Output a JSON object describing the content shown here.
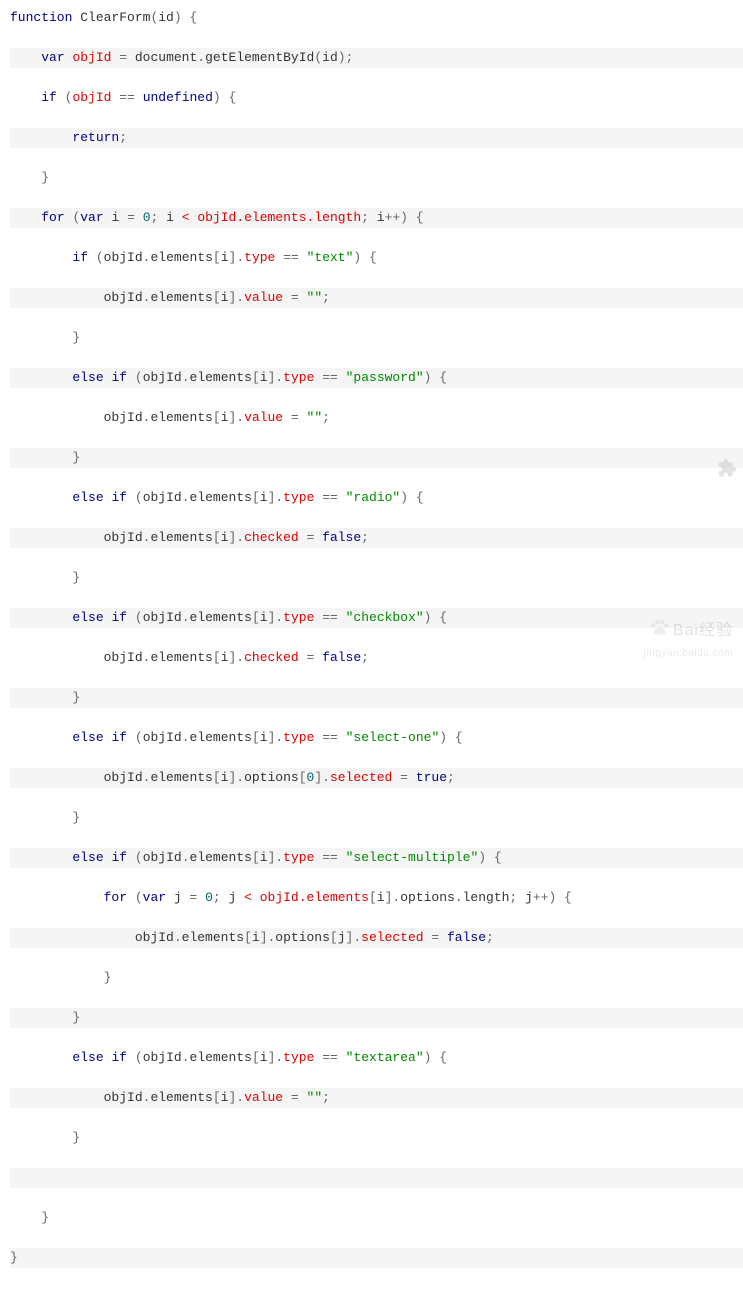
{
  "code": {
    "lines": [
      [
        [
          "kw",
          "function"
        ],
        [
          "id",
          " ClearForm"
        ],
        [
          "punc",
          "("
        ],
        [
          "id",
          "id"
        ],
        [
          "punc",
          ") {"
        ]
      ],
      [
        [
          "id",
          "    "
        ],
        [
          "kw",
          "var"
        ],
        [
          "id",
          " "
        ],
        [
          "err",
          "objId"
        ],
        [
          "id",
          " "
        ],
        [
          "punc",
          "="
        ],
        [
          "id",
          " document"
        ],
        [
          "punc",
          "."
        ],
        [
          "id",
          "getElementById"
        ],
        [
          "punc",
          "("
        ],
        [
          "id",
          "id"
        ],
        [
          "punc",
          ");"
        ]
      ],
      [
        [
          "id",
          "    "
        ],
        [
          "kw",
          "if"
        ],
        [
          "id",
          " "
        ],
        [
          "punc",
          "("
        ],
        [
          "err",
          "objId"
        ],
        [
          "id",
          " "
        ],
        [
          "punc",
          "=="
        ],
        [
          "id",
          " "
        ],
        [
          "bool",
          "undefined"
        ],
        [
          "punc",
          ") {"
        ]
      ],
      [
        [
          "id",
          "        "
        ],
        [
          "kw",
          "return"
        ],
        [
          "punc",
          ";"
        ]
      ],
      [
        [
          "id",
          "    "
        ],
        [
          "punc",
          "}"
        ]
      ],
      [
        [
          "id",
          "    "
        ],
        [
          "kw",
          "for"
        ],
        [
          "id",
          " "
        ],
        [
          "punc",
          "("
        ],
        [
          "kw",
          "var"
        ],
        [
          "id",
          " i "
        ],
        [
          "punc",
          "="
        ],
        [
          "id",
          " "
        ],
        [
          "num",
          "0"
        ],
        [
          "punc",
          ";"
        ],
        [
          "id",
          " i "
        ],
        [
          "err",
          "< objId.elements.length"
        ],
        [
          "punc",
          ";"
        ],
        [
          "id",
          " i"
        ],
        [
          "punc",
          "++) {"
        ]
      ],
      [
        [
          "id",
          "        "
        ],
        [
          "kw",
          "if"
        ],
        [
          "id",
          " "
        ],
        [
          "punc",
          "("
        ],
        [
          "id",
          "objId"
        ],
        [
          "punc",
          "."
        ],
        [
          "id",
          "elements"
        ],
        [
          "punc",
          "["
        ],
        [
          "id",
          "i"
        ],
        [
          "punc",
          "]."
        ],
        [
          "err",
          "type"
        ],
        [
          "id",
          " "
        ],
        [
          "punc",
          "=="
        ],
        [
          "id",
          " "
        ],
        [
          "str",
          "\"text\""
        ],
        [
          "punc",
          ") {"
        ]
      ],
      [
        [
          "id",
          "            objId"
        ],
        [
          "punc",
          "."
        ],
        [
          "id",
          "elements"
        ],
        [
          "punc",
          "["
        ],
        [
          "id",
          "i"
        ],
        [
          "punc",
          "]."
        ],
        [
          "err",
          "value"
        ],
        [
          "id",
          " "
        ],
        [
          "punc",
          "="
        ],
        [
          "id",
          " "
        ],
        [
          "str",
          "\"\""
        ],
        [
          "punc",
          ";"
        ]
      ],
      [
        [
          "id",
          "        "
        ],
        [
          "punc",
          "}"
        ]
      ],
      [
        [
          "id",
          "        "
        ],
        [
          "kw",
          "else"
        ],
        [
          "id",
          " "
        ],
        [
          "kw",
          "if"
        ],
        [
          "id",
          " "
        ],
        [
          "punc",
          "("
        ],
        [
          "id",
          "objId"
        ],
        [
          "punc",
          "."
        ],
        [
          "id",
          "elements"
        ],
        [
          "punc",
          "["
        ],
        [
          "id",
          "i"
        ],
        [
          "punc",
          "]."
        ],
        [
          "err",
          "type"
        ],
        [
          "id",
          " "
        ],
        [
          "punc",
          "=="
        ],
        [
          "id",
          " "
        ],
        [
          "str",
          "\"password\""
        ],
        [
          "punc",
          ") {"
        ]
      ],
      [
        [
          "id",
          "            objId"
        ],
        [
          "punc",
          "."
        ],
        [
          "id",
          "elements"
        ],
        [
          "punc",
          "["
        ],
        [
          "id",
          "i"
        ],
        [
          "punc",
          "]."
        ],
        [
          "err",
          "value"
        ],
        [
          "id",
          " "
        ],
        [
          "punc",
          "="
        ],
        [
          "id",
          " "
        ],
        [
          "str",
          "\"\""
        ],
        [
          "punc",
          ";"
        ]
      ],
      [
        [
          "id",
          "        "
        ],
        [
          "punc",
          "}"
        ]
      ],
      [
        [
          "id",
          "        "
        ],
        [
          "kw",
          "else"
        ],
        [
          "id",
          " "
        ],
        [
          "kw",
          "if"
        ],
        [
          "id",
          " "
        ],
        [
          "punc",
          "("
        ],
        [
          "id",
          "objId"
        ],
        [
          "punc",
          "."
        ],
        [
          "id",
          "elements"
        ],
        [
          "punc",
          "["
        ],
        [
          "id",
          "i"
        ],
        [
          "punc",
          "]."
        ],
        [
          "err",
          "type"
        ],
        [
          "id",
          " "
        ],
        [
          "punc",
          "=="
        ],
        [
          "id",
          " "
        ],
        [
          "str",
          "\"radio\""
        ],
        [
          "punc",
          ") {"
        ]
      ],
      [
        [
          "id",
          "            objId"
        ],
        [
          "punc",
          "."
        ],
        [
          "id",
          "elements"
        ],
        [
          "punc",
          "["
        ],
        [
          "id",
          "i"
        ],
        [
          "punc",
          "]."
        ],
        [
          "err",
          "checked"
        ],
        [
          "id",
          " "
        ],
        [
          "punc",
          "="
        ],
        [
          "id",
          " "
        ],
        [
          "bool",
          "false"
        ],
        [
          "punc",
          ";"
        ]
      ],
      [
        [
          "id",
          "        "
        ],
        [
          "punc",
          "}"
        ]
      ],
      [
        [
          "id",
          "        "
        ],
        [
          "kw",
          "else"
        ],
        [
          "id",
          " "
        ],
        [
          "kw",
          "if"
        ],
        [
          "id",
          " "
        ],
        [
          "punc",
          "("
        ],
        [
          "id",
          "objId"
        ],
        [
          "punc",
          "."
        ],
        [
          "id",
          "elements"
        ],
        [
          "punc",
          "["
        ],
        [
          "id",
          "i"
        ],
        [
          "punc",
          "]."
        ],
        [
          "err",
          "type"
        ],
        [
          "id",
          " "
        ],
        [
          "punc",
          "=="
        ],
        [
          "id",
          " "
        ],
        [
          "str",
          "\"checkbox\""
        ],
        [
          "punc",
          ") {"
        ]
      ],
      [
        [
          "id",
          "            objId"
        ],
        [
          "punc",
          "."
        ],
        [
          "id",
          "elements"
        ],
        [
          "punc",
          "["
        ],
        [
          "id",
          "i"
        ],
        [
          "punc",
          "]."
        ],
        [
          "err",
          "checked"
        ],
        [
          "id",
          " "
        ],
        [
          "punc",
          "="
        ],
        [
          "id",
          " "
        ],
        [
          "bool",
          "false"
        ],
        [
          "punc",
          ";"
        ]
      ],
      [
        [
          "id",
          "        "
        ],
        [
          "punc",
          "}"
        ]
      ],
      [
        [
          "id",
          "        "
        ],
        [
          "kw",
          "else"
        ],
        [
          "id",
          " "
        ],
        [
          "kw",
          "if"
        ],
        [
          "id",
          " "
        ],
        [
          "punc",
          "("
        ],
        [
          "id",
          "objId"
        ],
        [
          "punc",
          "."
        ],
        [
          "id",
          "elements"
        ],
        [
          "punc",
          "["
        ],
        [
          "id",
          "i"
        ],
        [
          "punc",
          "]."
        ],
        [
          "err",
          "type"
        ],
        [
          "id",
          " "
        ],
        [
          "punc",
          "=="
        ],
        [
          "id",
          " "
        ],
        [
          "str",
          "\"select-one\""
        ],
        [
          "punc",
          ") {"
        ]
      ],
      [
        [
          "id",
          "            objId"
        ],
        [
          "punc",
          "."
        ],
        [
          "id",
          "elements"
        ],
        [
          "punc",
          "["
        ],
        [
          "id",
          "i"
        ],
        [
          "punc",
          "]."
        ],
        [
          "id",
          "options"
        ],
        [
          "punc",
          "["
        ],
        [
          "num",
          "0"
        ],
        [
          "punc",
          "]."
        ],
        [
          "err",
          "selected"
        ],
        [
          "id",
          " "
        ],
        [
          "punc",
          "="
        ],
        [
          "id",
          " "
        ],
        [
          "bool",
          "true"
        ],
        [
          "punc",
          ";"
        ]
      ],
      [
        [
          "id",
          "        "
        ],
        [
          "punc",
          "}"
        ]
      ],
      [
        [
          "id",
          "        "
        ],
        [
          "kw",
          "else"
        ],
        [
          "id",
          " "
        ],
        [
          "kw",
          "if"
        ],
        [
          "id",
          " "
        ],
        [
          "punc",
          "("
        ],
        [
          "id",
          "objId"
        ],
        [
          "punc",
          "."
        ],
        [
          "id",
          "elements"
        ],
        [
          "punc",
          "["
        ],
        [
          "id",
          "i"
        ],
        [
          "punc",
          "]."
        ],
        [
          "err",
          "type"
        ],
        [
          "id",
          " "
        ],
        [
          "punc",
          "=="
        ],
        [
          "id",
          " "
        ],
        [
          "str",
          "\"select-multiple\""
        ],
        [
          "punc",
          ") {"
        ]
      ],
      [
        [
          "id",
          "            "
        ],
        [
          "kw",
          "for"
        ],
        [
          "id",
          " "
        ],
        [
          "punc",
          "("
        ],
        [
          "kw",
          "var"
        ],
        [
          "id",
          " j "
        ],
        [
          "punc",
          "="
        ],
        [
          "id",
          " "
        ],
        [
          "num",
          "0"
        ],
        [
          "punc",
          ";"
        ],
        [
          "id",
          " j "
        ],
        [
          "err",
          "< objId.elements"
        ],
        [
          "punc",
          "["
        ],
        [
          "id",
          "i"
        ],
        [
          "punc",
          "]."
        ],
        [
          "id",
          "options"
        ],
        [
          "punc",
          "."
        ],
        [
          "id",
          "length"
        ],
        [
          "punc",
          ";"
        ],
        [
          "id",
          " j"
        ],
        [
          "punc",
          "++) {"
        ]
      ],
      [
        [
          "id",
          "                objId"
        ],
        [
          "punc",
          "."
        ],
        [
          "id",
          "elements"
        ],
        [
          "punc",
          "["
        ],
        [
          "id",
          "i"
        ],
        [
          "punc",
          "]."
        ],
        [
          "id",
          "options"
        ],
        [
          "punc",
          "["
        ],
        [
          "id",
          "j"
        ],
        [
          "punc",
          "]."
        ],
        [
          "err",
          "selected"
        ],
        [
          "id",
          " "
        ],
        [
          "punc",
          "="
        ],
        [
          "id",
          " "
        ],
        [
          "bool",
          "false"
        ],
        [
          "punc",
          ";"
        ]
      ],
      [
        [
          "id",
          "            "
        ],
        [
          "punc",
          "}"
        ]
      ],
      [
        [
          "id",
          "        "
        ],
        [
          "punc",
          "}"
        ]
      ],
      [
        [
          "id",
          "        "
        ],
        [
          "kw",
          "else"
        ],
        [
          "id",
          " "
        ],
        [
          "kw",
          "if"
        ],
        [
          "id",
          " "
        ],
        [
          "punc",
          "("
        ],
        [
          "id",
          "objId"
        ],
        [
          "punc",
          "."
        ],
        [
          "id",
          "elements"
        ],
        [
          "punc",
          "["
        ],
        [
          "id",
          "i"
        ],
        [
          "punc",
          "]."
        ],
        [
          "err",
          "type"
        ],
        [
          "id",
          " "
        ],
        [
          "punc",
          "=="
        ],
        [
          "id",
          " "
        ],
        [
          "str",
          "\"textarea\""
        ],
        [
          "punc",
          ") {"
        ]
      ],
      [
        [
          "id",
          "            objId"
        ],
        [
          "punc",
          "."
        ],
        [
          "id",
          "elements"
        ],
        [
          "punc",
          "["
        ],
        [
          "id",
          "i"
        ],
        [
          "punc",
          "]."
        ],
        [
          "err",
          "value"
        ],
        [
          "id",
          " "
        ],
        [
          "punc",
          "="
        ],
        [
          "id",
          " "
        ],
        [
          "str",
          "\"\""
        ],
        [
          "punc",
          ";"
        ]
      ],
      [
        [
          "id",
          "        "
        ],
        [
          "punc",
          "}"
        ]
      ],
      [
        [
          "id",
          " "
        ]
      ],
      [
        [
          "id",
          "    "
        ],
        [
          "punc",
          "}"
        ]
      ],
      [
        [
          "punc",
          "}"
        ]
      ]
    ]
  },
  "watermark": {
    "brand": "Bai",
    "brand_suffix": "经验",
    "sub": "jingyan.baidu.com"
  }
}
